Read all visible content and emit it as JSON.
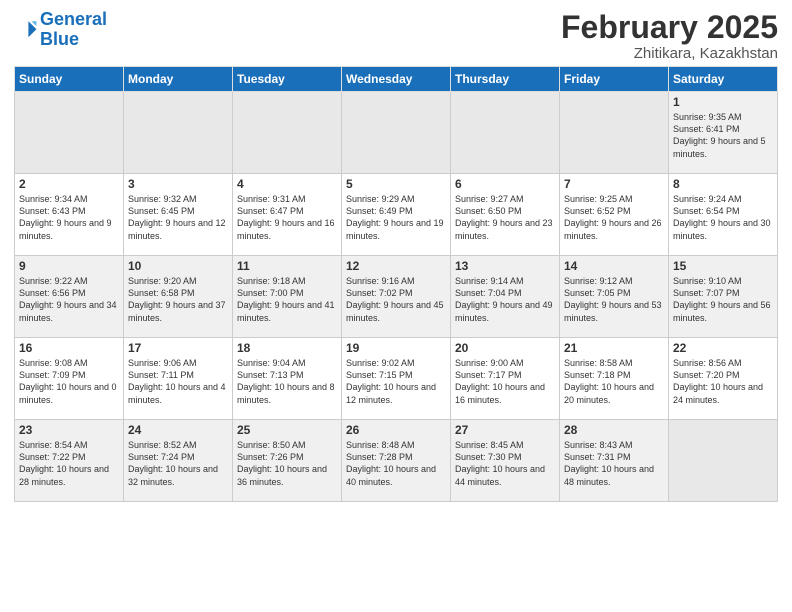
{
  "header": {
    "logo_line1": "General",
    "logo_line2": "Blue",
    "month": "February 2025",
    "location": "Zhitikara, Kazakhstan"
  },
  "days_of_week": [
    "Sunday",
    "Monday",
    "Tuesday",
    "Wednesday",
    "Thursday",
    "Friday",
    "Saturday"
  ],
  "weeks": [
    [
      {
        "day": "",
        "info": ""
      },
      {
        "day": "",
        "info": ""
      },
      {
        "day": "",
        "info": ""
      },
      {
        "day": "",
        "info": ""
      },
      {
        "day": "",
        "info": ""
      },
      {
        "day": "",
        "info": ""
      },
      {
        "day": "1",
        "info": "Sunrise: 9:35 AM\nSunset: 6:41 PM\nDaylight: 9 hours and 5 minutes."
      }
    ],
    [
      {
        "day": "2",
        "info": "Sunrise: 9:34 AM\nSunset: 6:43 PM\nDaylight: 9 hours and 9 minutes."
      },
      {
        "day": "3",
        "info": "Sunrise: 9:32 AM\nSunset: 6:45 PM\nDaylight: 9 hours and 12 minutes."
      },
      {
        "day": "4",
        "info": "Sunrise: 9:31 AM\nSunset: 6:47 PM\nDaylight: 9 hours and 16 minutes."
      },
      {
        "day": "5",
        "info": "Sunrise: 9:29 AM\nSunset: 6:49 PM\nDaylight: 9 hours and 19 minutes."
      },
      {
        "day": "6",
        "info": "Sunrise: 9:27 AM\nSunset: 6:50 PM\nDaylight: 9 hours and 23 minutes."
      },
      {
        "day": "7",
        "info": "Sunrise: 9:25 AM\nSunset: 6:52 PM\nDaylight: 9 hours and 26 minutes."
      },
      {
        "day": "8",
        "info": "Sunrise: 9:24 AM\nSunset: 6:54 PM\nDaylight: 9 hours and 30 minutes."
      }
    ],
    [
      {
        "day": "9",
        "info": "Sunrise: 9:22 AM\nSunset: 6:56 PM\nDaylight: 9 hours and 34 minutes."
      },
      {
        "day": "10",
        "info": "Sunrise: 9:20 AM\nSunset: 6:58 PM\nDaylight: 9 hours and 37 minutes."
      },
      {
        "day": "11",
        "info": "Sunrise: 9:18 AM\nSunset: 7:00 PM\nDaylight: 9 hours and 41 minutes."
      },
      {
        "day": "12",
        "info": "Sunrise: 9:16 AM\nSunset: 7:02 PM\nDaylight: 9 hours and 45 minutes."
      },
      {
        "day": "13",
        "info": "Sunrise: 9:14 AM\nSunset: 7:04 PM\nDaylight: 9 hours and 49 minutes."
      },
      {
        "day": "14",
        "info": "Sunrise: 9:12 AM\nSunset: 7:05 PM\nDaylight: 9 hours and 53 minutes."
      },
      {
        "day": "15",
        "info": "Sunrise: 9:10 AM\nSunset: 7:07 PM\nDaylight: 9 hours and 56 minutes."
      }
    ],
    [
      {
        "day": "16",
        "info": "Sunrise: 9:08 AM\nSunset: 7:09 PM\nDaylight: 10 hours and 0 minutes."
      },
      {
        "day": "17",
        "info": "Sunrise: 9:06 AM\nSunset: 7:11 PM\nDaylight: 10 hours and 4 minutes."
      },
      {
        "day": "18",
        "info": "Sunrise: 9:04 AM\nSunset: 7:13 PM\nDaylight: 10 hours and 8 minutes."
      },
      {
        "day": "19",
        "info": "Sunrise: 9:02 AM\nSunset: 7:15 PM\nDaylight: 10 hours and 12 minutes."
      },
      {
        "day": "20",
        "info": "Sunrise: 9:00 AM\nSunset: 7:17 PM\nDaylight: 10 hours and 16 minutes."
      },
      {
        "day": "21",
        "info": "Sunrise: 8:58 AM\nSunset: 7:18 PM\nDaylight: 10 hours and 20 minutes."
      },
      {
        "day": "22",
        "info": "Sunrise: 8:56 AM\nSunset: 7:20 PM\nDaylight: 10 hours and 24 minutes."
      }
    ],
    [
      {
        "day": "23",
        "info": "Sunrise: 8:54 AM\nSunset: 7:22 PM\nDaylight: 10 hours and 28 minutes."
      },
      {
        "day": "24",
        "info": "Sunrise: 8:52 AM\nSunset: 7:24 PM\nDaylight: 10 hours and 32 minutes."
      },
      {
        "day": "25",
        "info": "Sunrise: 8:50 AM\nSunset: 7:26 PM\nDaylight: 10 hours and 36 minutes."
      },
      {
        "day": "26",
        "info": "Sunrise: 8:48 AM\nSunset: 7:28 PM\nDaylight: 10 hours and 40 minutes."
      },
      {
        "day": "27",
        "info": "Sunrise: 8:45 AM\nSunset: 7:30 PM\nDaylight: 10 hours and 44 minutes."
      },
      {
        "day": "28",
        "info": "Sunrise: 8:43 AM\nSunset: 7:31 PM\nDaylight: 10 hours and 48 minutes."
      },
      {
        "day": "",
        "info": ""
      }
    ]
  ]
}
